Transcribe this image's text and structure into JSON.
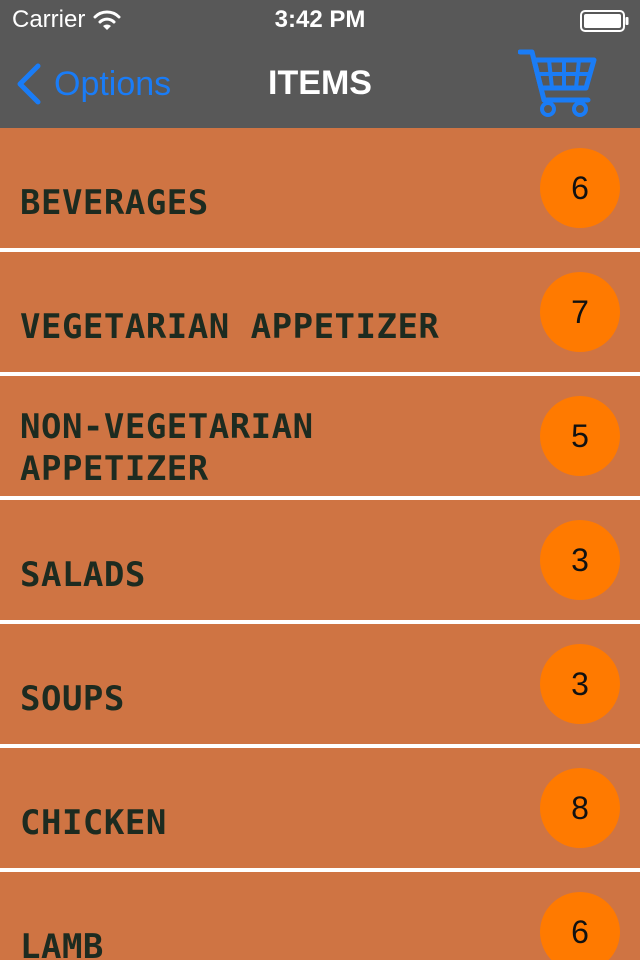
{
  "status_bar": {
    "carrier": "Carrier",
    "time": "3:42 PM"
  },
  "nav": {
    "back_label": "Options",
    "title": "ITEMS",
    "cart_icon": "shopping-cart-icon"
  },
  "colors": {
    "nav_background": "#585858",
    "accent_blue": "#1a7cf6",
    "row_background": "#cf7443",
    "badge_background": "#ff7a00",
    "row_text": "#1d2b20"
  },
  "categories": [
    {
      "label": "BEVERAGES",
      "count": "6"
    },
    {
      "label": "VEGETARIAN APPETIZER",
      "count": "7"
    },
    {
      "label": "NON-VEGETARIAN APPETIZER",
      "count": "5"
    },
    {
      "label": "SALADS",
      "count": "3"
    },
    {
      "label": "SOUPS",
      "count": "3"
    },
    {
      "label": "CHICKEN",
      "count": "8"
    },
    {
      "label": "LAMB",
      "count": "6"
    }
  ]
}
